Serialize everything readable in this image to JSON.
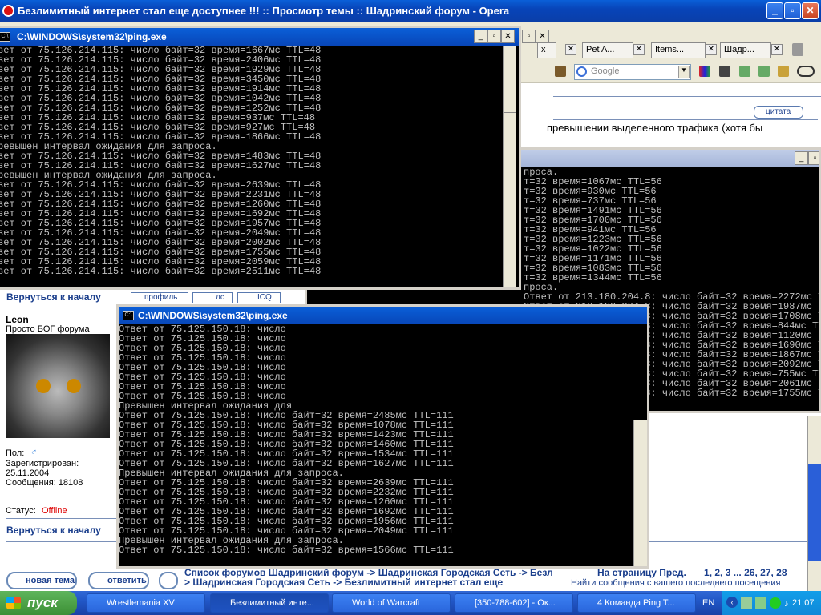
{
  "opera": {
    "title": "Безлимитный интернет стал еще доступнее !!! :: Просмотр темы :: Шадринский форум - Opera"
  },
  "tabs": [
    {
      "label": "Pet A..."
    },
    {
      "label": "Items..."
    },
    {
      "label": "Шадр..."
    }
  ],
  "search": {
    "placeholder": "Google"
  },
  "forum": {
    "quote_label": "цитата",
    "text_fragment": "превышении выделенного трафика (хотя бы",
    "back_to_top": "Вернуться к началу",
    "profile_btn": "профиль",
    "pm_btn": "лс",
    "icq_btn": "ICQ",
    "user": {
      "name": "Leon",
      "rank": "Просто БОГ форума",
      "gender": "Пол:",
      "registered_label": "Зарегистрирован:",
      "registered": "25.11.2004",
      "posts": "Сообщения: 18108",
      "status_label": "Статус:",
      "status": "Offline"
    },
    "back_to_top2": "Вернуться к началу",
    "new_topic": "новая тема",
    "reply": "ответить",
    "breadcrumb": "Список форумов Шадринский форум -> Шадринская Городская Сеть -> Безлимитный интернет стал еще",
    "breadcrumb2": "> Шадринская Городская Сеть -> Безлимитный интернет стал еще",
    "pages": "На страницу Пред.",
    "page_links": [
      "1",
      "2",
      "3",
      "...",
      "26",
      "27",
      "28"
    ],
    "find_posts": "Найти сообщения с вашего последнего посещения"
  },
  "cmd1": {
    "title": "C:\\WINDOWS\\system32\\ping.exe",
    "lines": [
      "вет от 75.126.214.115: число байт=32 время=1667мс TTL=48",
      "вет от 75.126.214.115: число байт=32 время=2406мс TTL=48",
      "вет от 75.126.214.115: число байт=32 время=1929мс TTL=48",
      "вет от 75.126.214.115: число байт=32 время=3450мс TTL=48",
      "вет от 75.126.214.115: число байт=32 время=1914мс TTL=48",
      "вет от 75.126.214.115: число байт=32 время=1042мс TTL=48",
      "вет от 75.126.214.115: число байт=32 время=1252мс TTL=48",
      "вет от 75.126.214.115: число байт=32 время=937мс TTL=48",
      "вет от 75.126.214.115: число байт=32 время=927мс TTL=48",
      "вет от 75.126.214.115: число байт=32 время=1866мс TTL=48",
      "ревышен интервал ожидания для запроса.",
      "вет от 75.126.214.115: число байт=32 время=1483мс TTL=48",
      "вет от 75.126.214.115: число байт=32 время=1627мс TTL=48",
      "ревышен интервал ожидания для запроса.",
      "вет от 75.126.214.115: число байт=32 время=2639мс TTL=48",
      "вет от 75.126.214.115: число байт=32 время=2231мс TTL=48",
      "вет от 75.126.214.115: число байт=32 время=1260мс TTL=48",
      "вет от 75.126.214.115: число байт=32 время=1692мс TTL=48",
      "вет от 75.126.214.115: число байт=32 время=1957мс TTL=48",
      "вет от 75.126.214.115: число байт=32 время=2049мс TTL=48",
      "вет от 75.126.214.115: число байт=32 время=2002мс TTL=48",
      "вет от 75.126.214.115: число байт=32 время=1755мс TTL=48",
      "вет от 75.126.214.115: число байт=32 время=2059мс TTL=48",
      "вет от 75.126.214.115: число байт=32 время=2511мс TTL=48"
    ]
  },
  "cmd2": {
    "lines": [
      "проса.",
      "т=32 время=1067мс TTL=56",
      "т=32 время=930мс TTL=56",
      "т=32 время=737мс TTL=56",
      "т=32 время=1491мс TTL=56",
      "т=32 время=1700мс TTL=56",
      "т=32 время=941мс TTL=56",
      "т=32 время=1223мс TTL=56",
      "т=32 время=1022мс TTL=56",
      "т=32 время=1171мс TTL=56",
      "т=32 время=1083мс TTL=56",
      "т=32 время=1344мс TTL=56",
      "проса.",
      "Ответ от 213.180.204.8: число байт=32 время=2272мс TTL=56",
      "Ответ от 213.180.204.8: число байт=32 время=1987мс TTL=56",
      "Ответ от 213.180.204.8: число байт=32 время=1708мс TTL=56",
      "Ответ от 213.180.204.8: число байт=32 время=844мс TTL=56",
      "Ответ от 213.180.204.8: число байт=32 время=1120мс TTL=56",
      "Ответ от 213.180.204.8: число байт=32 время=1690мс TTL=56",
      "Ответ от 213.180.204.8: число байт=32 время=1867мс TTL=56",
      "Ответ от 213.180.204.8: число байт=32 время=2092мс TTL=56",
      "Ответ от 213.180.204.8: число байт=32 время=755мс TTL=56",
      "Ответ от 213.180.204.8: число байт=32 время=2061мс TTL=56",
      "Ответ от 213.180.204.8: число байт=32 время=1755мс TTL=56"
    ]
  },
  "cmd3": {
    "title": "C:\\WINDOWS\\system32\\ping.exe",
    "lines": [
      "Ответ от 75.125.150.18: число",
      "Ответ от 75.125.150.18: число",
      "Ответ от 75.125.150.18: число",
      "Ответ от 75.125.150.18: число",
      "Ответ от 75.125.150.18: число",
      "Ответ от 75.125.150.18: число",
      "Ответ от 75.125.150.18: число",
      "Ответ от 75.125.150.18: число",
      "Превышен интервал ожидания для",
      "Ответ от 75.125.150.18: число байт=32 время=2485мс TTL=111",
      "Ответ от 75.125.150.18: число байт=32 время=1078мс TTL=111",
      "Ответ от 75.125.150.18: число байт=32 время=1423мс TTL=111",
      "Ответ от 75.125.150.18: число байт=32 время=1460мс TTL=111",
      "Ответ от 75.125.150.18: число байт=32 время=1534мс TTL=111",
      "Ответ от 75.125.150.18: число байт=32 время=1627мс TTL=111",
      "Превышен интервал ожидания для запроса.",
      "Ответ от 75.125.150.18: число байт=32 время=2639мс TTL=111",
      "Ответ от 75.125.150.18: число байт=32 время=2232мс TTL=111",
      "Ответ от 75.125.150.18: число байт=32 время=1260мс TTL=111",
      "Ответ от 75.125.150.18: число байт=32 время=1692мс TTL=111",
      "Ответ от 75.125.150.18: число байт=32 время=1956мс TTL=111",
      "Ответ от 75.125.150.18: число байт=32 время=2049мс TTL=111",
      "Превышен интервал ожидания для запроса.",
      "Ответ от 75.125.150.18: число байт=32 время=1566мс TTL=111"
    ]
  },
  "taskbar": {
    "start": "пуск",
    "items": [
      {
        "label": "Wrestlemania XV"
      },
      {
        "label": "Безлимитный инте..."
      },
      {
        "label": "World of Warcraft"
      },
      {
        "label": "[350-788-602] - Ок..."
      },
      {
        "label": "4 Команда Ping T..."
      }
    ],
    "lang": "EN",
    "clock": "21:07"
  }
}
